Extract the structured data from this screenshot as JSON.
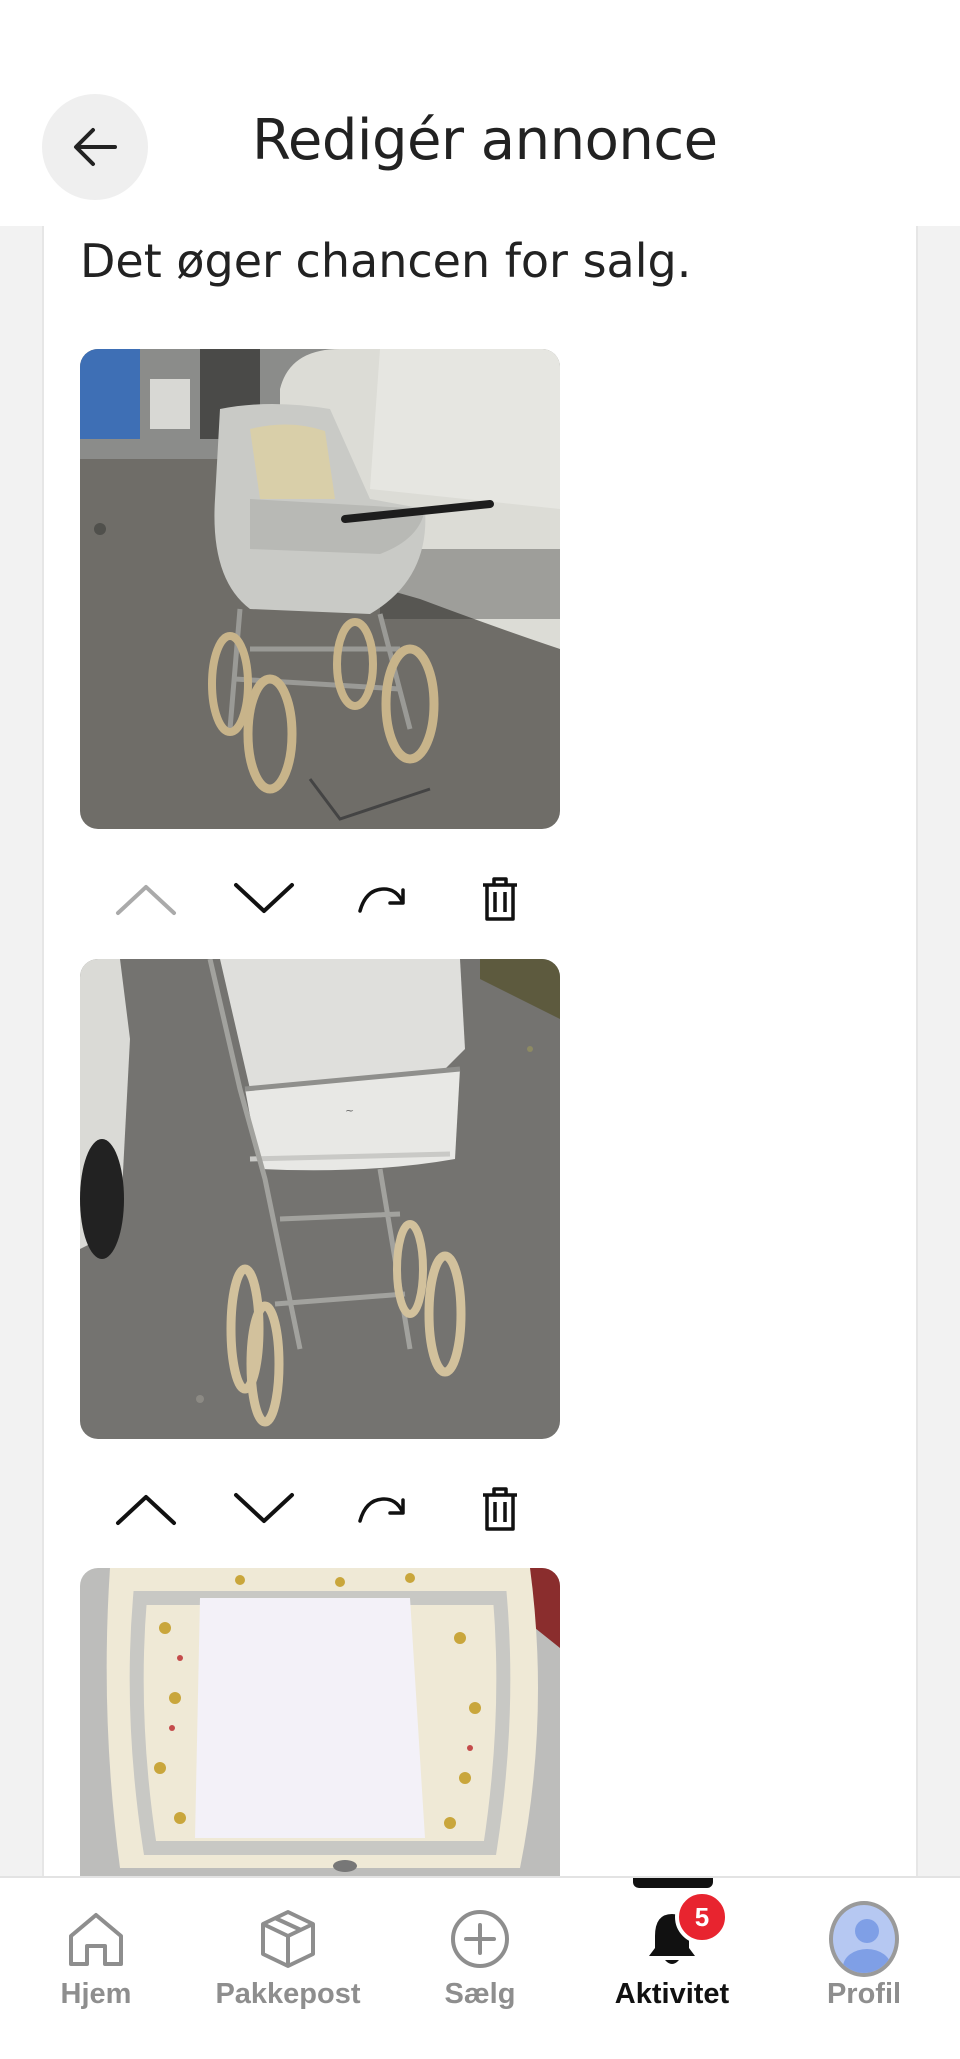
{
  "header": {
    "title": "Redigér annonce",
    "back_icon": "arrow-left-icon"
  },
  "content": {
    "hint_text": "Det øger chancen for salg.",
    "photos": [
      {
        "subject": "vintage white pram on gravel",
        "controls": {
          "move_up_enabled": false,
          "move_down_enabled": true
        }
      },
      {
        "subject": "vintage white pram rear view",
        "controls": {
          "move_up_enabled": true,
          "move_down_enabled": true
        }
      },
      {
        "subject": "pram bassinet interior with floral lining",
        "controls": {
          "move_up_enabled": true,
          "move_down_enabled": true
        }
      }
    ],
    "control_icons": [
      "chevron-up-icon",
      "chevron-down-icon",
      "rotate-icon",
      "trash-icon"
    ]
  },
  "bottom_nav": {
    "items": [
      {
        "label": "Hjem",
        "icon": "home-icon"
      },
      {
        "label": "Pakkepost",
        "icon": "package-icon"
      },
      {
        "label": "Sælg",
        "icon": "plus-circle-icon"
      },
      {
        "label": "Aktivitet",
        "icon": "bell-icon",
        "active": true,
        "badge": "5"
      },
      {
        "label": "Profil",
        "icon": "avatar-icon"
      }
    ]
  },
  "colors": {
    "badge": "#e8242f",
    "inactive_label": "#8e8e8e",
    "active_label": "#111111",
    "disabled_icon": "#aaaaaa"
  }
}
